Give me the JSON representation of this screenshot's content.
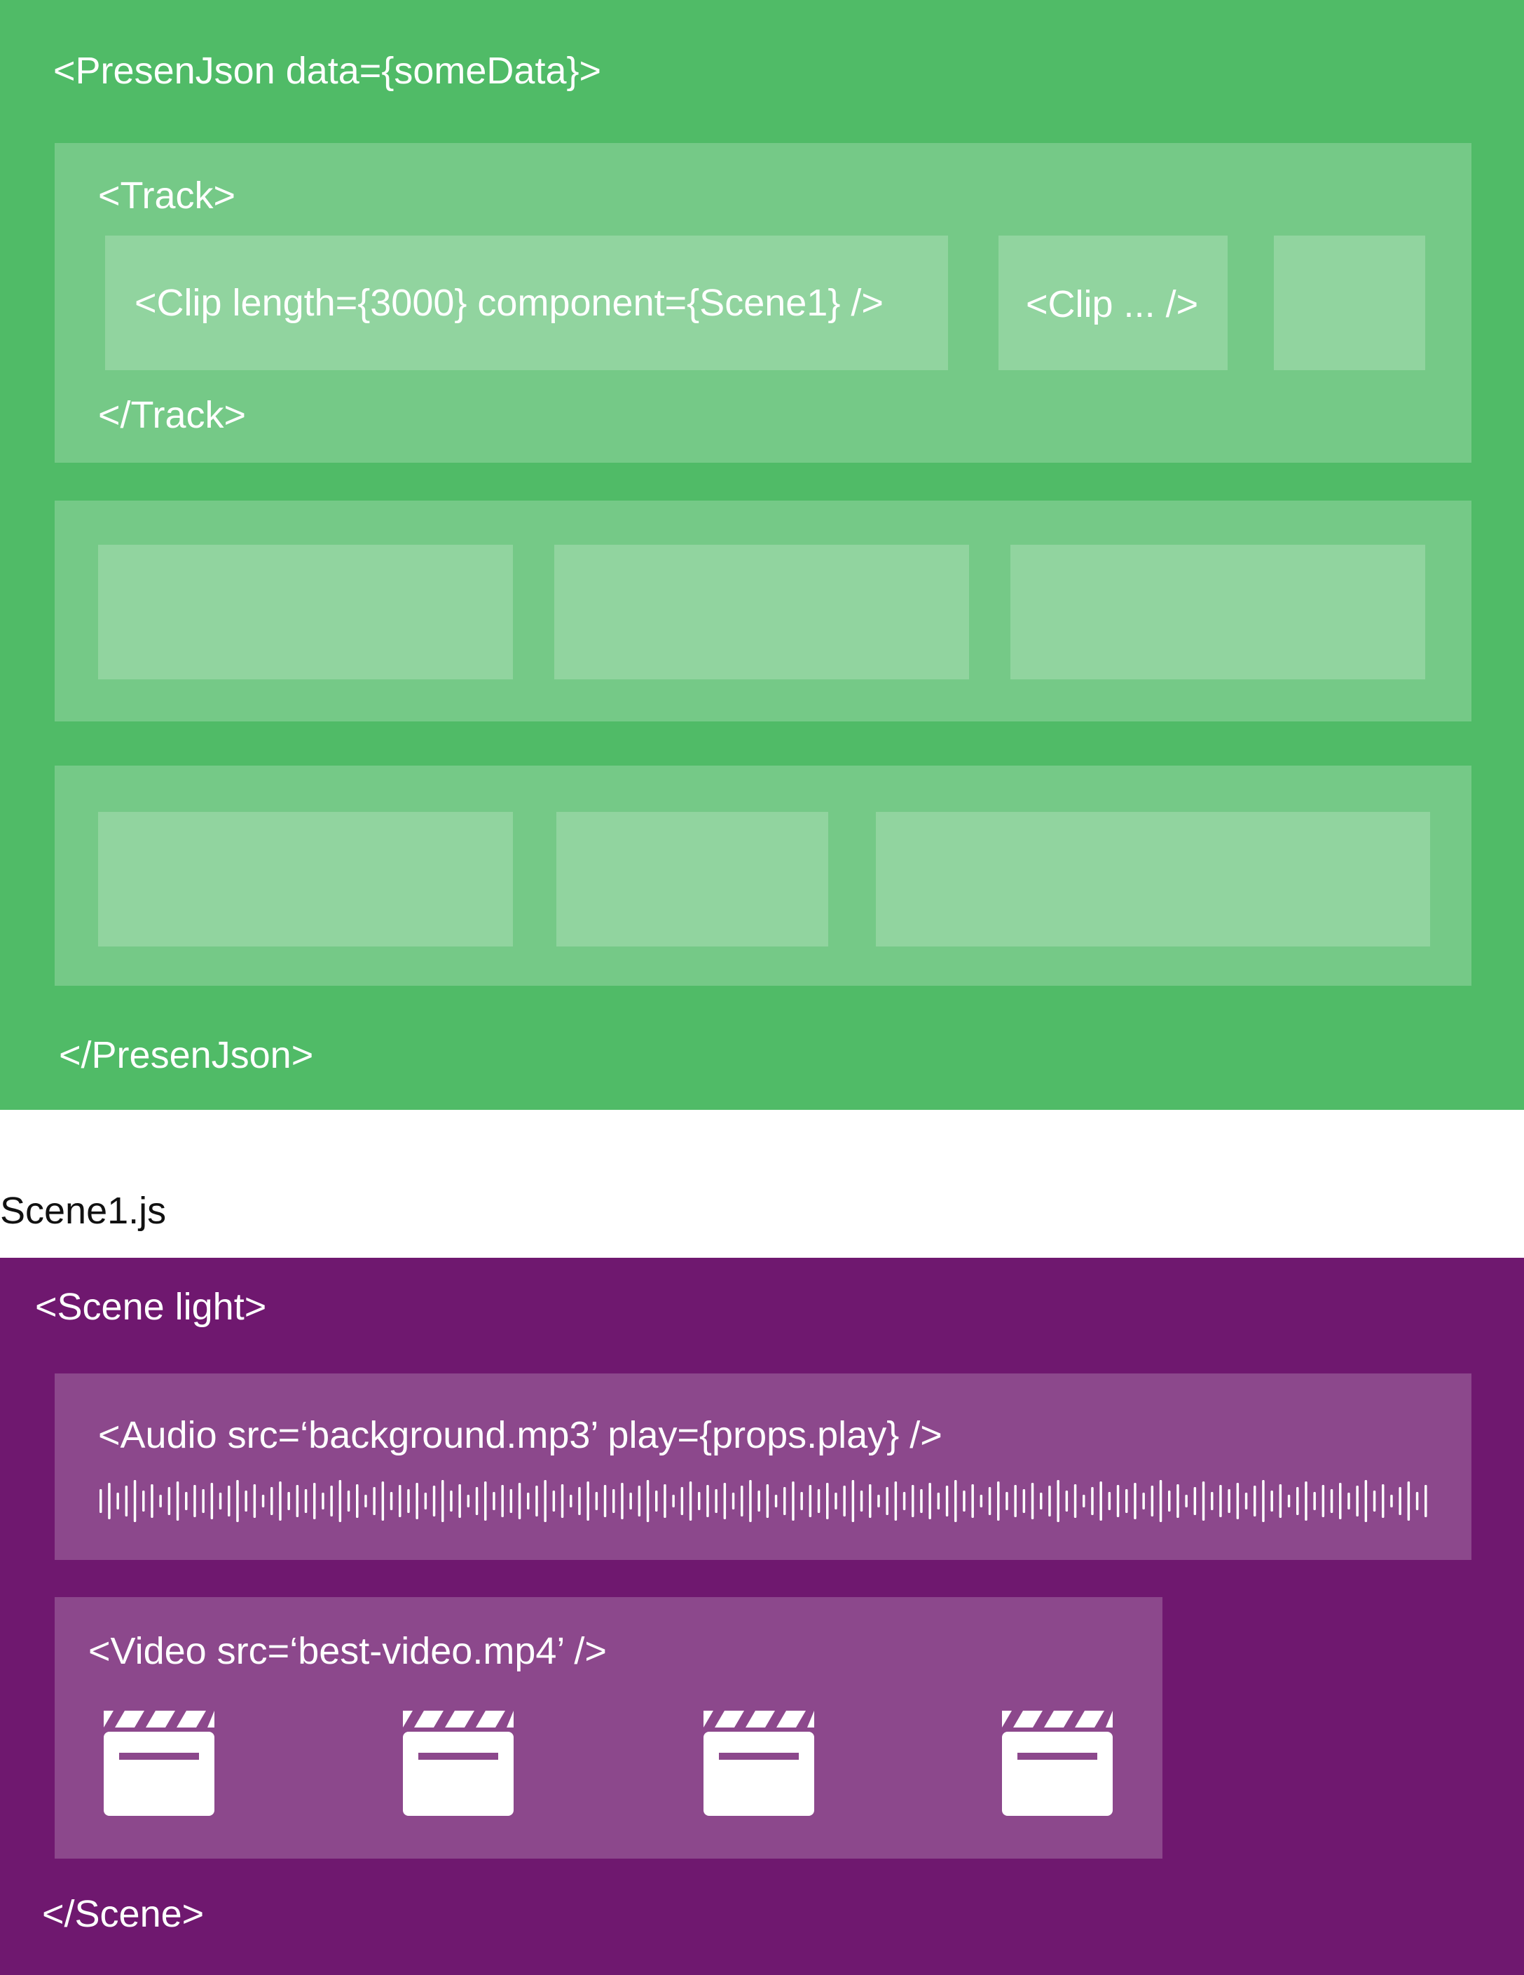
{
  "presenjson": {
    "open_tag": "<PresenJson data={someData}>",
    "close_tag": "</PresenJson>"
  },
  "track1": {
    "open_tag": "<Track>",
    "close_tag": "</Track>",
    "clip1_label": "<Clip length={3000} component={Scene1} />",
    "clip2_label": "<Clip ... />"
  },
  "scene_file": {
    "name": "Scene1.js"
  },
  "scene": {
    "open_tag": "<Scene light>",
    "close_tag": "</Scene>",
    "audio_label": "<Audio src=‘background.mp3’ play={props.play} />",
    "video_label": "<Video src=‘best-video.mp4’ />"
  },
  "icons": {
    "waveform": "audio-waveform-icon",
    "clapperboard": "clapperboard-icon"
  },
  "colors": {
    "green_bg": "#50bb67",
    "track_bg": "#75c987",
    "clip_bg": "#91d49f",
    "purple_bg": "#6f186f",
    "purple_box_bg": "#8c488c"
  }
}
